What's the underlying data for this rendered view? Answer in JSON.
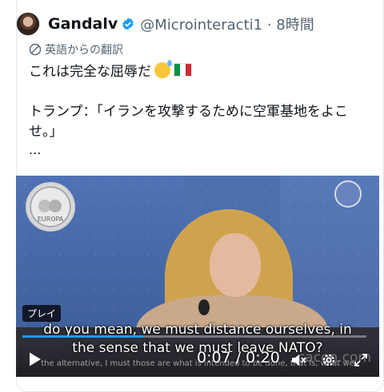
{
  "tweet": {
    "display_name": "Gandalv",
    "handle": "@Microinteracti1",
    "separator": "·",
    "time": "8時間",
    "translation_label": "英語からの翻訳",
    "line1": "これは完全な屈辱だ",
    "line2": "トランプ：「イランを攻撃するために空軍基地をよこせ。」",
    "ellipsis": "..."
  },
  "video": {
    "seal_text": "EUROPA",
    "tooltip": "プレイ",
    "subtitle_line1": "do you mean, we must distance ourselves, in",
    "subtitle_line2": "the sense that we must leave NATO?",
    "subtitle_faint": "the alternative, I must those are what is intended to be done, that is, what we",
    "time_display": "0:07 / 0:20",
    "progress_fraction": 0.35,
    "watermark": "cacon.com"
  },
  "colors": {
    "verified": "#1d9bf0",
    "accent": "#1d9bf0"
  },
  "icons": [
    "avatar",
    "verified-icon",
    "translate-icon",
    "play-icon",
    "mute-icon",
    "settings-icon",
    "fullscreen-icon"
  ]
}
